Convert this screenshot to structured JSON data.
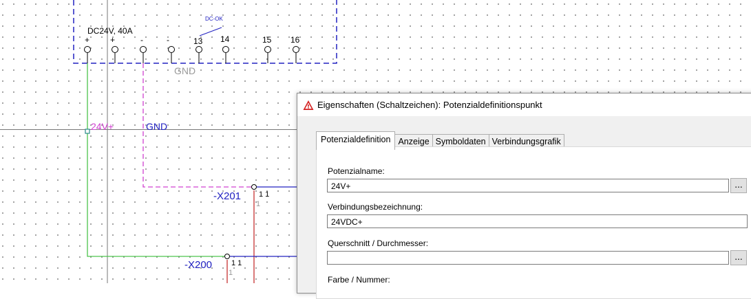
{
  "schematic": {
    "device_label": "DC24V, 40A",
    "dc_ok_label": "DC-OK",
    "terminals": [
      "+",
      "+",
      "-",
      "-",
      "13",
      "14",
      "15",
      "16"
    ],
    "gnd_device_label": "GND",
    "potential_24v": "24V+",
    "potential_gnd": "GND",
    "x201_label": "-X201",
    "x201_terminal": "1 1",
    "x201_sub": "1",
    "x200_label": "-X200",
    "x200_terminal": "1 1",
    "x200_sub": "1",
    "colors": {
      "green": "#4cc44c",
      "magenta": "#d040d0",
      "blue": "#2020c0",
      "red": "#c02020",
      "gray": "#9a9a9a"
    }
  },
  "dialog": {
    "title": "Eigenschaften (Schaltzeichen): Potenzialdefinitionspunkt",
    "tabs": [
      "Potenzialdefinition",
      "Anzeige",
      "Symboldaten",
      "Verbindungsgrafik"
    ],
    "active_tab": "Potenzialdefinition",
    "fields": {
      "potenzialname_label": "Potenzialname:",
      "potenzialname_value": "24V+",
      "verbindung_label": "Verbindungsbezeichnung:",
      "verbindung_value": "24VDC+",
      "querschnitt_label": "Querschnitt / Durchmesser:",
      "querschnitt_value": "",
      "farbe_label": "Farbe / Nummer:"
    },
    "browse_button": "...",
    "icon": "warning-triangle-icon"
  }
}
